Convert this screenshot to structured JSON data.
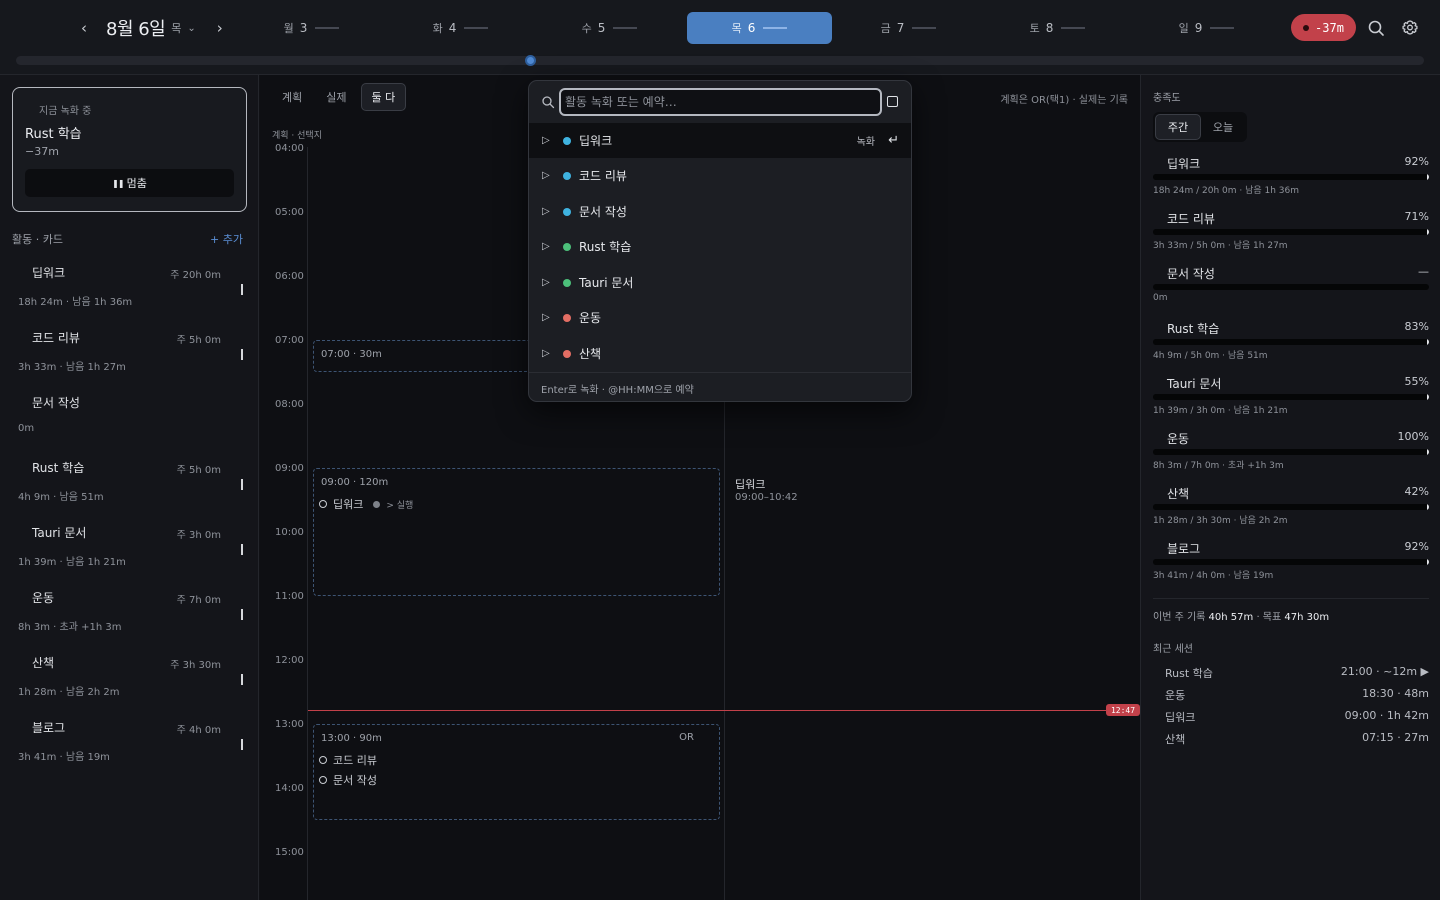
{
  "header": {
    "date": "8월 6일",
    "dow": "목",
    "prev_icon": "‹",
    "next_icon": "›",
    "caret_icon": "⌄",
    "days": [
      {
        "dow": "월",
        "num": "3",
        "active": false
      },
      {
        "dow": "화",
        "num": "4",
        "active": false
      },
      {
        "dow": "수",
        "num": "5",
        "active": false
      },
      {
        "dow": "목",
        "num": "6",
        "active": true
      },
      {
        "dow": "금",
        "num": "7",
        "active": false
      },
      {
        "dow": "토",
        "num": "8",
        "active": false
      },
      {
        "dow": "일",
        "num": "9",
        "active": false
      }
    ],
    "over_badge": "-37m",
    "accent_color": "#4a7fc1",
    "alert_color": "#c2414a",
    "icons": [
      "search-icon",
      "gear-icon"
    ]
  },
  "recording": {
    "label": "지금 녹화 중",
    "title": "Rust 학습",
    "delta": "−37m",
    "pause_icon": "❚❚",
    "pause_label": "멈춤"
  },
  "activities": {
    "header": "활동 · 카드",
    "add": "+ 추가",
    "items": [
      {
        "name": "딥워크",
        "goal": "주 20h 0m",
        "stat": "18h 24m · 남음 1h 36m",
        "has_tick": true
      },
      {
        "name": "코드 리뷰",
        "goal": "주 5h 0m",
        "stat": "3h 33m · 남음 1h 27m",
        "has_tick": true
      },
      {
        "name": "문서 작성",
        "goal": "",
        "stat": "0m",
        "has_tick": false
      },
      {
        "name": "Rust 학습",
        "goal": "주 5h 0m",
        "stat": "4h 9m · 남음 51m",
        "has_tick": true
      },
      {
        "name": "Tauri 문서",
        "goal": "주 3h 0m",
        "stat": "1h 39m · 남음 1h 21m",
        "has_tick": true
      },
      {
        "name": "운동",
        "goal": "주 7h 0m",
        "stat": "8h 3m · 초과 +1h 3m",
        "has_tick": true
      },
      {
        "name": "산책",
        "goal": "주 3h 30m",
        "stat": "1h 28m · 남음 2h 2m",
        "has_tick": true
      },
      {
        "name": "블로그",
        "goal": "주 4h 0m",
        "stat": "3h 41m · 남음 19m",
        "has_tick": true
      }
    ]
  },
  "center": {
    "modes": [
      {
        "label": "계획",
        "active": false
      },
      {
        "label": "실제",
        "active": false
      },
      {
        "label": "둘 다",
        "active": true
      }
    ],
    "plan_hint": "계획은 OR(택1) · 실제는 기록",
    "sub_header": "계획 · 선택지",
    "hours": [
      "04:00",
      "05:00",
      "06:00",
      "07:00",
      "08:00",
      "09:00",
      "10:00",
      "11:00",
      "12:00",
      "13:00",
      "14:00",
      "15:00"
    ],
    "plan_blocks": [
      {
        "head": "07:00 · 30m",
        "items": []
      },
      {
        "head": "09:00 · 120m",
        "items": [
          {
            "name": "딥워크",
            "run": "> 실행"
          }
        ]
      },
      {
        "head": "13:00 · 90m",
        "or_tag": "OR",
        "items": [
          {
            "name": "코드 리뷰"
          },
          {
            "name": "문서 작성"
          }
        ]
      }
    ],
    "actual": {
      "name": "딥워크",
      "time": "09:00–10:42"
    },
    "now": "12:47"
  },
  "palette": {
    "placeholder": "활동 녹화 또는 예약…",
    "value": "",
    "items": [
      {
        "name": "딥워크",
        "color": "#3fb3e0",
        "hint": "녹화",
        "enter": "↵",
        "selected": true
      },
      {
        "name": "코드 리뷰",
        "color": "#3fb3e0"
      },
      {
        "name": "문서 작성",
        "color": "#3fb3e0"
      },
      {
        "name": "Rust 학습",
        "color": "#4cc07a"
      },
      {
        "name": "Tauri 문서",
        "color": "#4cc07a"
      },
      {
        "name": "운동",
        "color": "#e36e64"
      },
      {
        "name": "산책",
        "color": "#e36e64"
      }
    ],
    "footer": "Enter로 녹화 · @HH:MM으로 예약"
  },
  "fill": {
    "title": "충족도",
    "tabs": [
      {
        "label": "주간",
        "active": true
      },
      {
        "label": "오늘",
        "active": false
      }
    ],
    "items": [
      {
        "name": "딥워크",
        "pct": "92%",
        "value": 0.92,
        "stat": "18h 24m / 20h 0m · 남음 1h 36m"
      },
      {
        "name": "코드 리뷰",
        "pct": "71%",
        "value": 0.71,
        "stat": "3h 33m / 5h 0m · 남음 1h 27m"
      },
      {
        "name": "문서 작성",
        "pct": "—",
        "value": 0,
        "stat": "0m"
      },
      {
        "name": "Rust 학습",
        "pct": "83%",
        "value": 0.83,
        "stat": "4h 9m / 5h 0m · 남음 51m"
      },
      {
        "name": "Tauri 문서",
        "pct": "55%",
        "value": 0.55,
        "stat": "1h 39m / 3h 0m · 남음 1h 21m"
      },
      {
        "name": "운동",
        "pct": "100%",
        "value": 1.0,
        "stat": "8h 3m / 7h 0m · 초과 +1h 3m"
      },
      {
        "name": "산책",
        "pct": "42%",
        "value": 0.42,
        "stat": "1h 28m / 3h 30m · 남음 2h 2m"
      },
      {
        "name": "블로그",
        "pct": "92%",
        "value": 0.92,
        "stat": "3h 41m / 4h 0m · 남음 19m"
      }
    ],
    "week_label": "이번 주 기록",
    "week_value": "40h 57m",
    "goal_label": "· 목표",
    "goal_value": "47h 30m"
  },
  "recent": {
    "title": "최근 세션",
    "items": [
      {
        "name": "Rust 학습",
        "meta": "21:00 · ~12m ▶"
      },
      {
        "name": "운동",
        "meta": "18:30 · 48m"
      },
      {
        "name": "딥워크",
        "meta": "09:00 · 1h 42m"
      },
      {
        "name": "산책",
        "meta": "07:15 · 27m"
      }
    ]
  }
}
